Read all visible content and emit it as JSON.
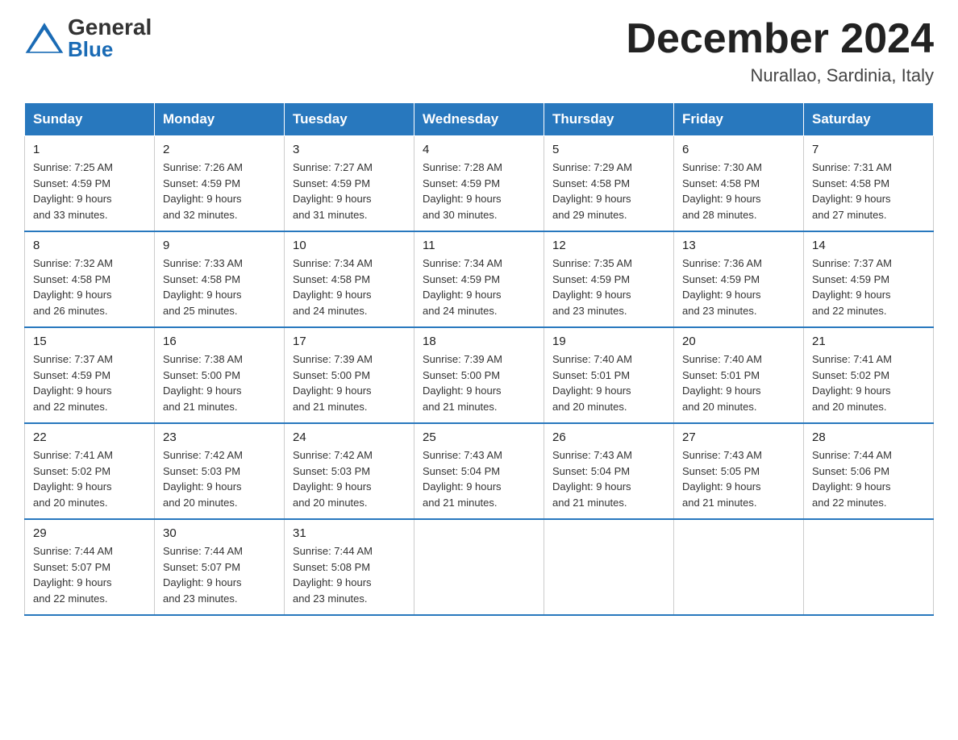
{
  "header": {
    "logo_general": "General",
    "logo_blue": "Blue",
    "month_title": "December 2024",
    "location": "Nurallao, Sardinia, Italy"
  },
  "days_of_week": [
    "Sunday",
    "Monday",
    "Tuesday",
    "Wednesday",
    "Thursday",
    "Friday",
    "Saturday"
  ],
  "weeks": [
    [
      {
        "day": "1",
        "sunrise": "7:25 AM",
        "sunset": "4:59 PM",
        "daylight": "9 hours and 33 minutes."
      },
      {
        "day": "2",
        "sunrise": "7:26 AM",
        "sunset": "4:59 PM",
        "daylight": "9 hours and 32 minutes."
      },
      {
        "day": "3",
        "sunrise": "7:27 AM",
        "sunset": "4:59 PM",
        "daylight": "9 hours and 31 minutes."
      },
      {
        "day": "4",
        "sunrise": "7:28 AM",
        "sunset": "4:59 PM",
        "daylight": "9 hours and 30 minutes."
      },
      {
        "day": "5",
        "sunrise": "7:29 AM",
        "sunset": "4:58 PM",
        "daylight": "9 hours and 29 minutes."
      },
      {
        "day": "6",
        "sunrise": "7:30 AM",
        "sunset": "4:58 PM",
        "daylight": "9 hours and 28 minutes."
      },
      {
        "day": "7",
        "sunrise": "7:31 AM",
        "sunset": "4:58 PM",
        "daylight": "9 hours and 27 minutes."
      }
    ],
    [
      {
        "day": "8",
        "sunrise": "7:32 AM",
        "sunset": "4:58 PM",
        "daylight": "9 hours and 26 minutes."
      },
      {
        "day": "9",
        "sunrise": "7:33 AM",
        "sunset": "4:58 PM",
        "daylight": "9 hours and 25 minutes."
      },
      {
        "day": "10",
        "sunrise": "7:34 AM",
        "sunset": "4:58 PM",
        "daylight": "9 hours and 24 minutes."
      },
      {
        "day": "11",
        "sunrise": "7:34 AM",
        "sunset": "4:59 PM",
        "daylight": "9 hours and 24 minutes."
      },
      {
        "day": "12",
        "sunrise": "7:35 AM",
        "sunset": "4:59 PM",
        "daylight": "9 hours and 23 minutes."
      },
      {
        "day": "13",
        "sunrise": "7:36 AM",
        "sunset": "4:59 PM",
        "daylight": "9 hours and 23 minutes."
      },
      {
        "day": "14",
        "sunrise": "7:37 AM",
        "sunset": "4:59 PM",
        "daylight": "9 hours and 22 minutes."
      }
    ],
    [
      {
        "day": "15",
        "sunrise": "7:37 AM",
        "sunset": "4:59 PM",
        "daylight": "9 hours and 22 minutes."
      },
      {
        "day": "16",
        "sunrise": "7:38 AM",
        "sunset": "5:00 PM",
        "daylight": "9 hours and 21 minutes."
      },
      {
        "day": "17",
        "sunrise": "7:39 AM",
        "sunset": "5:00 PM",
        "daylight": "9 hours and 21 minutes."
      },
      {
        "day": "18",
        "sunrise": "7:39 AM",
        "sunset": "5:00 PM",
        "daylight": "9 hours and 21 minutes."
      },
      {
        "day": "19",
        "sunrise": "7:40 AM",
        "sunset": "5:01 PM",
        "daylight": "9 hours and 20 minutes."
      },
      {
        "day": "20",
        "sunrise": "7:40 AM",
        "sunset": "5:01 PM",
        "daylight": "9 hours and 20 minutes."
      },
      {
        "day": "21",
        "sunrise": "7:41 AM",
        "sunset": "5:02 PM",
        "daylight": "9 hours and 20 minutes."
      }
    ],
    [
      {
        "day": "22",
        "sunrise": "7:41 AM",
        "sunset": "5:02 PM",
        "daylight": "9 hours and 20 minutes."
      },
      {
        "day": "23",
        "sunrise": "7:42 AM",
        "sunset": "5:03 PM",
        "daylight": "9 hours and 20 minutes."
      },
      {
        "day": "24",
        "sunrise": "7:42 AM",
        "sunset": "5:03 PM",
        "daylight": "9 hours and 20 minutes."
      },
      {
        "day": "25",
        "sunrise": "7:43 AM",
        "sunset": "5:04 PM",
        "daylight": "9 hours and 21 minutes."
      },
      {
        "day": "26",
        "sunrise": "7:43 AM",
        "sunset": "5:04 PM",
        "daylight": "9 hours and 21 minutes."
      },
      {
        "day": "27",
        "sunrise": "7:43 AM",
        "sunset": "5:05 PM",
        "daylight": "9 hours and 21 minutes."
      },
      {
        "day": "28",
        "sunrise": "7:44 AM",
        "sunset": "5:06 PM",
        "daylight": "9 hours and 22 minutes."
      }
    ],
    [
      {
        "day": "29",
        "sunrise": "7:44 AM",
        "sunset": "5:07 PM",
        "daylight": "9 hours and 22 minutes."
      },
      {
        "day": "30",
        "sunrise": "7:44 AM",
        "sunset": "5:07 PM",
        "daylight": "9 hours and 23 minutes."
      },
      {
        "day": "31",
        "sunrise": "7:44 AM",
        "sunset": "5:08 PM",
        "daylight": "9 hours and 23 minutes."
      },
      null,
      null,
      null,
      null
    ]
  ],
  "labels": {
    "sunrise": "Sunrise:",
    "sunset": "Sunset:",
    "daylight": "Daylight:"
  },
  "colors": {
    "header_bg": "#2878be",
    "accent_blue": "#1a6bb5"
  }
}
